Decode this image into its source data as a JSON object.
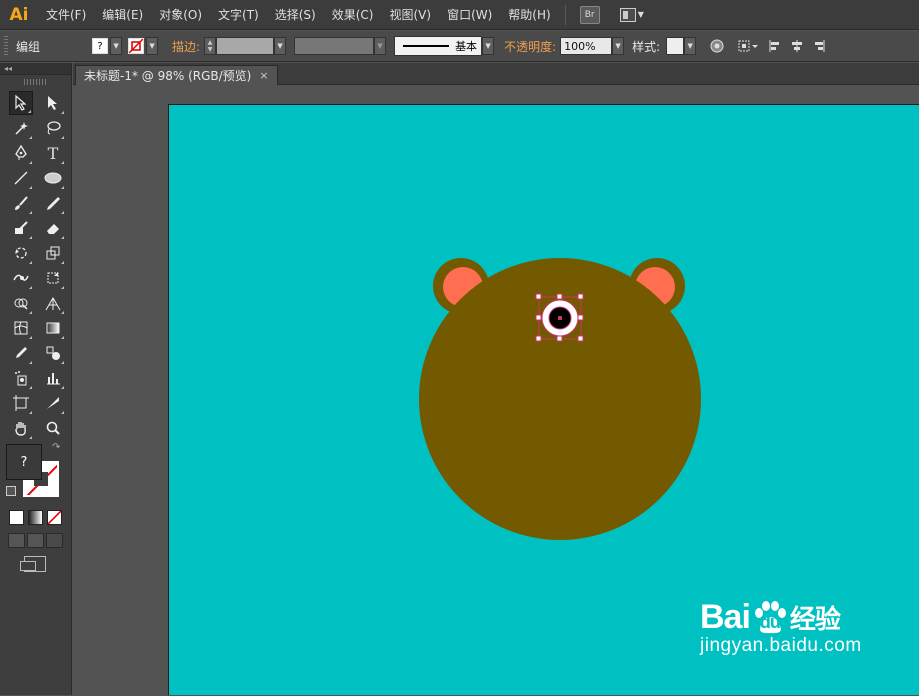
{
  "app": {
    "logo": "Ai",
    "menus": [
      "文件(F)",
      "编辑(E)",
      "对象(O)",
      "文字(T)",
      "选择(S)",
      "效果(C)",
      "视图(V)",
      "窗口(W)",
      "帮助(H)"
    ],
    "bridge_label": "Br"
  },
  "control_bar": {
    "selection_type": "编组",
    "fill_value": "?",
    "stroke_label": "描边:",
    "stroke_profile": "基本",
    "opacity_label": "不透明度:",
    "opacity_value": "100%",
    "style_label": "样式:"
  },
  "document_tab": {
    "title": "未标题-1* @ 98% (RGB/预览)",
    "close": "×"
  },
  "tool_panel": {
    "collapse": "◂◂",
    "fill_placeholder": "?"
  },
  "colors": {
    "artboard_bg": "#00c1c1",
    "bear_fur": "#735a00",
    "ear_inner": "#ff6e50",
    "eye_white": "#ffffff",
    "pupil": "#000000",
    "selection": "#cc3366",
    "accent_orange": "#f0a050"
  },
  "watermark": {
    "brand": "Bai",
    "brand2": "du",
    "suffix": "经验",
    "url": "jingyan.baidu.com"
  }
}
